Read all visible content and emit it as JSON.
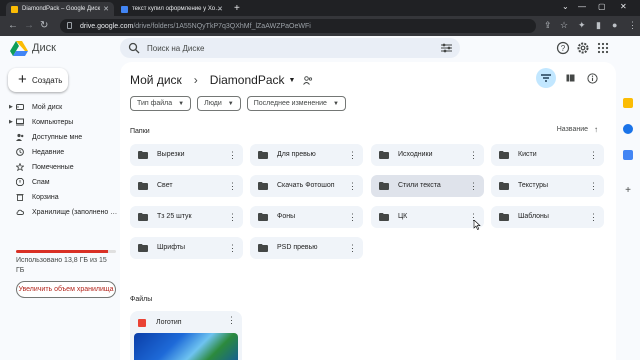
{
  "browser": {
    "tabs": [
      {
        "title": "DiamondPack – Google Диск",
        "active": true
      },
      {
        "title": "текст купил оформление у Хо…",
        "active": false
      }
    ],
    "new_tab": "+",
    "url_host": "drive.google.com",
    "url_path": "/drive/folders/1A55NQyTkP7q3QXhMf_lZaAWZPaOeWFi"
  },
  "header": {
    "app_name": "Диск",
    "search_placeholder": "Поиск на Диске"
  },
  "sidebar": {
    "create_label": "Создать",
    "items": [
      {
        "label": "Мой диск",
        "icon": "drive-icon"
      },
      {
        "label": "Компьютеры",
        "icon": "computer-icon"
      },
      {
        "label": "Доступные мне",
        "icon": "shared-icon"
      },
      {
        "label": "Недавние",
        "icon": "clock-icon"
      },
      {
        "label": "Помеченные",
        "icon": "star-icon"
      },
      {
        "label": "Спам",
        "icon": "spam-icon"
      },
      {
        "label": "Корзина",
        "icon": "trash-icon"
      },
      {
        "label": "Хранилище (заполнено …",
        "icon": "cloud-icon"
      }
    ],
    "storage_text": "Использовано 13,8 ГБ из 15 ГБ",
    "storage_fraction": 0.92,
    "upgrade_label": "Увеличить объем хранилища"
  },
  "main": {
    "breadcrumb_root": "Мой диск",
    "breadcrumb_sep": "›",
    "breadcrumb_current": "DiamondPack",
    "filters": [
      "Тип файла",
      "Люди",
      "Последнее изменение"
    ],
    "folders_title": "Папки",
    "sort_label": "Название",
    "folders": [
      "Вырезки",
      "Для превью",
      "Исходники",
      "Кисти",
      "Свет",
      "Скачать Фотошоп",
      "Стили текста",
      "Текстуры",
      "Тз 25 штук",
      "Фоны",
      "ЦК",
      "Шаблоны",
      "Шрифты",
      "PSD превью"
    ],
    "files_title": "Файлы",
    "files": [
      {
        "name": "Логотип"
      }
    ]
  },
  "colors": {
    "accent": "#c2e7ff",
    "danger": "#d93025",
    "folder_bg": "#f0f4f9"
  }
}
